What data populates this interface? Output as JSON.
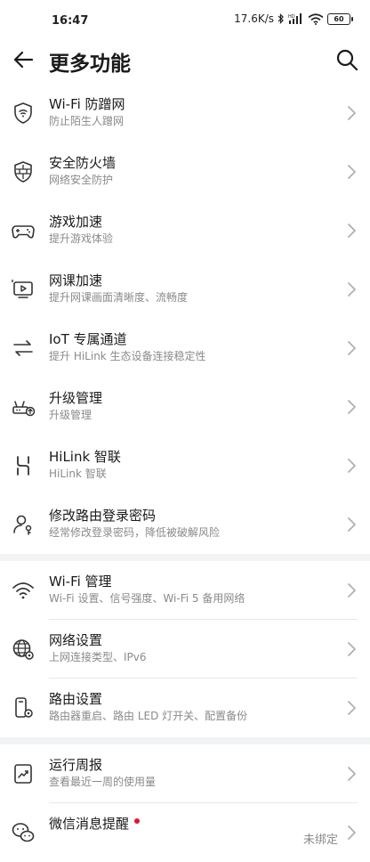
{
  "status_bar": {
    "time": "16:47",
    "net_speed": "17.6K/s",
    "battery": "60"
  },
  "header": {
    "title": "更多功能"
  },
  "section1": [
    {
      "title": "Wi-Fi 防蹭网",
      "subtitle": "防止陌生人蹭网",
      "icon": "shield-wifi-icon"
    },
    {
      "title": "安全防火墙",
      "subtitle": "网络安全防护",
      "icon": "firewall-icon"
    },
    {
      "title": "游戏加速",
      "subtitle": "提升游戏体验",
      "icon": "gamepad-icon"
    },
    {
      "title": "网课加速",
      "subtitle": "提升网课画面清晰度、流畅度",
      "icon": "video-lesson-icon"
    },
    {
      "title": "IoT 专属通道",
      "subtitle": "提升 HiLink 生态设备连接稳定性",
      "icon": "iot-channel-icon"
    },
    {
      "title": "升级管理",
      "subtitle": "升级管理",
      "icon": "router-upgrade-icon"
    },
    {
      "title": "HiLink 智联",
      "subtitle": "HiLink 智联",
      "icon": "hilink-icon"
    },
    {
      "title": "修改路由登录密码",
      "subtitle": "经常修改登录密码，降低被破解风险",
      "icon": "user-key-icon"
    }
  ],
  "section2": [
    {
      "title": "Wi-Fi 管理",
      "subtitle": "Wi-Fi 设置、信号强度、Wi-Fi 5 备用网络",
      "icon": "wifi-icon"
    },
    {
      "title": "网络设置",
      "subtitle": "上网连接类型、IPv6",
      "icon": "globe-gear-icon"
    },
    {
      "title": "路由设置",
      "subtitle": "路由器重启、路由 LED 灯开关、配置备份",
      "icon": "router-gear-icon"
    }
  ],
  "section3": [
    {
      "title": "运行周报",
      "subtitle": "查看最近一周的使用量",
      "icon": "weekly-report-icon"
    },
    {
      "title": "微信消息提醒",
      "status": "未绑定",
      "icon": "wechat-icon"
    }
  ]
}
